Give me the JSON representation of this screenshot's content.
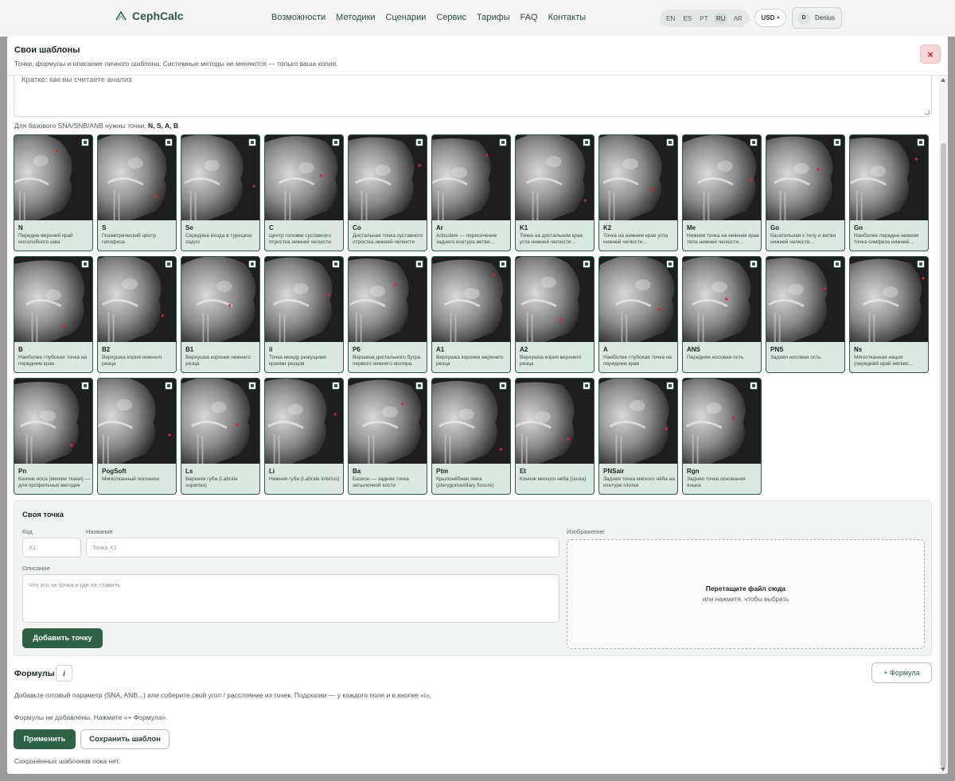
{
  "nav": {
    "logo": "CephCalc",
    "links": [
      "Возможности",
      "Методики",
      "Сценарии",
      "Сервис",
      "Тарифы",
      "FAQ",
      "Контакты"
    ],
    "languages": [
      "EN",
      "ES",
      "PT",
      "RU",
      "AR"
    ],
    "active_language": "RU",
    "currency": "USD",
    "user_initial": "D",
    "user_name": "Denius"
  },
  "modal": {
    "title": "Свои шаблоны",
    "subtitle": "Точки, формулы и описание личного шаблона. Системные методы не меняются — только ваша копия.",
    "close": "×",
    "description_placeholder": "Кратко: как вы считаете анализ",
    "needs_prefix": "Для базового SNA/SNB/ANB нужны точки:",
    "needs_points": "N, S, A, B",
    "needs_suffix": "."
  },
  "points": [
    {
      "code": "N",
      "desc": "Передне-верхний край носолобного шва",
      "checked": true
    },
    {
      "code": "S",
      "desc": "Геометрический центр гипофиза",
      "checked": true
    },
    {
      "code": "Se",
      "desc": "Середина входа в турецкое седло",
      "checked": true
    },
    {
      "code": "C",
      "desc": "Центр головки суставного отростка нижней челюсти",
      "checked": true
    },
    {
      "code": "Co",
      "desc": "Дистальная точка суставного отростка нижней челюсти",
      "checked": true
    },
    {
      "code": "Ar",
      "desc": "Articulare — пересечение заднего контура ветви…",
      "checked": true
    },
    {
      "code": "K1",
      "desc": "Точка на дистальном крае угла нижней челюсти…",
      "checked": true
    },
    {
      "code": "K2",
      "desc": "Точка на нижнем крае угла нижней челюсти…",
      "checked": true
    },
    {
      "code": "Me",
      "desc": "Нижняя точка на нижнем крае тела нижней челюсти…",
      "checked": true
    },
    {
      "code": "Go",
      "desc": "Касательная к телу и ветви нижней челюсти…",
      "checked": true
    },
    {
      "code": "Gn",
      "desc": "Наиболее передне-нижняя точка симфиза нижней…",
      "checked": true
    },
    {
      "code": "B",
      "desc": "Наиболее глубокая точка на переднем крае альвеолярного…",
      "checked": true
    },
    {
      "code": "B2",
      "desc": "Верхушка корня нижнего резца",
      "checked": true
    },
    {
      "code": "B1",
      "desc": "Верхушка коронки нижнего резца",
      "checked": true
    },
    {
      "code": "ii",
      "desc": "Точка между режущими краями резцов",
      "checked": true
    },
    {
      "code": "P6",
      "desc": "Вершина дистального бугра первого нижнего моляра",
      "checked": true
    },
    {
      "code": "A1",
      "desc": "Верхушка коронки верхнего резца",
      "checked": true
    },
    {
      "code": "A2",
      "desc": "Верхушка корня верхнего резца",
      "checked": true
    },
    {
      "code": "A",
      "desc": "Наиболее глубокая точка на переднем крае альвеолярного…",
      "checked": true
    },
    {
      "code": "ANS",
      "desc": "Передняя носовая ость",
      "checked": true
    },
    {
      "code": "PNS",
      "desc": "Задняя носовая ость",
      "checked": true
    },
    {
      "code": "Ns",
      "desc": "Мягкотканная нация (передний край мягких…",
      "checked": true
    },
    {
      "code": "Pn",
      "desc": "Кончик носа (мягкие ткани) — для профильных методик",
      "checked": true
    },
    {
      "code": "PogSoft",
      "desc": "Мягкотканный погонион",
      "checked": true
    },
    {
      "code": "Ls",
      "desc": "Верхняя губа (Labrale superius)",
      "checked": true
    },
    {
      "code": "Li",
      "desc": "Нижняя губа (Labrale inferius)",
      "checked": true
    },
    {
      "code": "Ba",
      "desc": "Базион — задняя точка затылочной кости",
      "checked": true
    },
    {
      "code": "Ptm",
      "desc": "Крылонёбная ямка (pterygomaxillary fissure)",
      "checked": true
    },
    {
      "code": "Et",
      "desc": "Кончик мягкого нёба (uvula)",
      "checked": true
    },
    {
      "code": "PNSair",
      "desc": "Задняя точка мягкого нёба на контуре глотки",
      "checked": true
    },
    {
      "code": "Rgn",
      "desc": "Задняя точка основания языка",
      "checked": true
    }
  ],
  "custom_point": {
    "title": "Своя точка",
    "code_label": "Код",
    "code_placeholder": "X1",
    "name_label": "Название",
    "name_placeholder": "Точка X1",
    "desc_label": "Описание",
    "desc_placeholder": "Что это за точка и где её ставить",
    "image_label": "Изображение",
    "drop_title": "Перетащите файл сюда",
    "drop_sub": "или нажмите, чтобы выбрать",
    "add_button": "Добавить точку"
  },
  "formulas": {
    "title": "Формулы",
    "info": "i",
    "add_button": "+ Формула",
    "hint": "Добавьте готовый параметр (SNA, ANB...) или соберите свой угол / расстояние из точек. Подсказки — у каждого поля и в кнопке «i».",
    "empty": "Формулы не добавлены. Нажмите «+ Формула».",
    "apply_button": "Применить",
    "save_button": "Сохранить шаблон",
    "no_templates": "Сохранённых шаблонов пока нет."
  },
  "colors": {
    "accent": "#2d6148",
    "card_bg": "#dbe8e1",
    "close_bg": "#f7d5d8"
  }
}
